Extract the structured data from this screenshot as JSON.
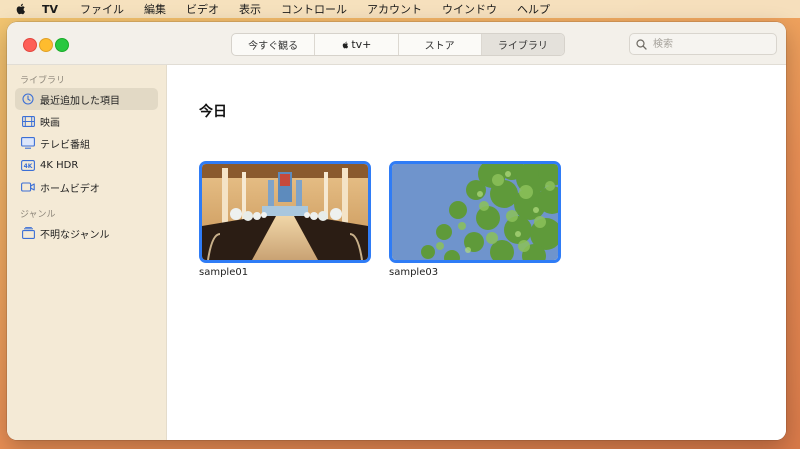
{
  "menubar": {
    "app": "TV",
    "items": [
      "ファイル",
      "編集",
      "ビデオ",
      "表示",
      "コントロール",
      "アカウント",
      "ウインドウ",
      "ヘルプ"
    ]
  },
  "toolbar": {
    "tabs": [
      {
        "label": "今すぐ観る"
      },
      {
        "label": "tv+"
      },
      {
        "label": "ストア"
      },
      {
        "label": "ライブラリ"
      }
    ],
    "search_placeholder": "検索"
  },
  "sidebar": {
    "sections": [
      {
        "title": "ライブラリ",
        "items": [
          {
            "label": "最近追加した項目",
            "icon": "clock-icon"
          },
          {
            "label": "映画",
            "icon": "film-icon"
          },
          {
            "label": "テレビ番組",
            "icon": "tv-icon"
          },
          {
            "label": "4K HDR",
            "icon": "4k-icon"
          },
          {
            "label": "ホームビデオ",
            "icon": "video-camera-icon"
          }
        ]
      },
      {
        "title": "ジャンル",
        "items": [
          {
            "label": "不明なジャンル",
            "icon": "genre-stack-icon"
          }
        ]
      }
    ]
  },
  "main": {
    "heading": "今日",
    "videos": [
      {
        "title": "sample01"
      },
      {
        "title": "sample03"
      }
    ]
  },
  "colors": {
    "accent": "#2f7cf6",
    "sidebar_bg": "#f4ead6",
    "selection": "#e2d9c5"
  }
}
